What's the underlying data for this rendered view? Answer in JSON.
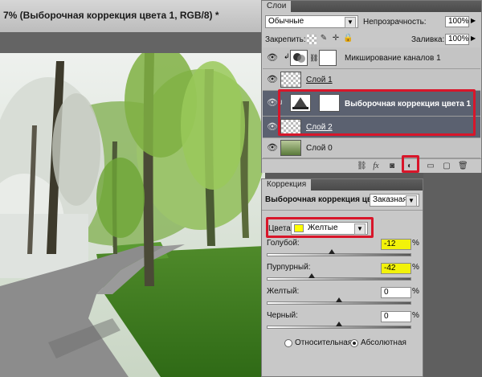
{
  "document": {
    "title": "7% (Выборочная коррекция цвета 1, RGB/8) *"
  },
  "layers_panel": {
    "tab_label": "Слои",
    "blend_mode": "Обычные",
    "opacity_label": "Непрозрачность:",
    "opacity_value": "100%",
    "lock_label": "Закрепить:",
    "fill_label": "Заливка:",
    "fill_value": "100%",
    "layers": [
      {
        "name": "Микширование каналов 1",
        "type": "adjustment",
        "selected": false
      },
      {
        "name": "Слой 1",
        "type": "pixel",
        "selected": false
      },
      {
        "name": "Выборочная коррекция цвета 1",
        "type": "adjustment",
        "selected": true
      },
      {
        "name": "Слой 2",
        "type": "pixel",
        "selected": true
      },
      {
        "name": "Слой 0",
        "type": "photo",
        "selected": false
      }
    ],
    "bottom_icons": [
      "link-icon",
      "fx-icon",
      "mask-icon",
      "adjustment-layer-icon",
      "folder-icon",
      "new-layer-icon",
      "trash-icon"
    ]
  },
  "adjustments_panel": {
    "tab_label": "Коррекция",
    "title": "Выборочная коррекция цвета",
    "preset": "Заказная",
    "colors_label": "Цвета:",
    "colors_value": "Желтые",
    "colors_swatch": "#ffff00",
    "sliders": [
      {
        "label": "Голубой:",
        "value": "-12",
        "highlight": true,
        "level": 0.44
      },
      {
        "label": "Пурпурный:",
        "value": "-42",
        "highlight": true,
        "level": 0.29
      },
      {
        "label": "Желтый:",
        "value": "0",
        "highlight": false,
        "level": 0.5
      },
      {
        "label": "Черный:",
        "value": "0",
        "highlight": false,
        "level": 0.5
      }
    ],
    "percent": "%",
    "method_relative": "Относительная",
    "method_absolute": "Абсолютная",
    "method_selected": "absolute"
  },
  "colors": {
    "highlight_red": "#d8162a",
    "highlight_yellow": "#f2f20a",
    "selected_row": "#5b6170"
  }
}
